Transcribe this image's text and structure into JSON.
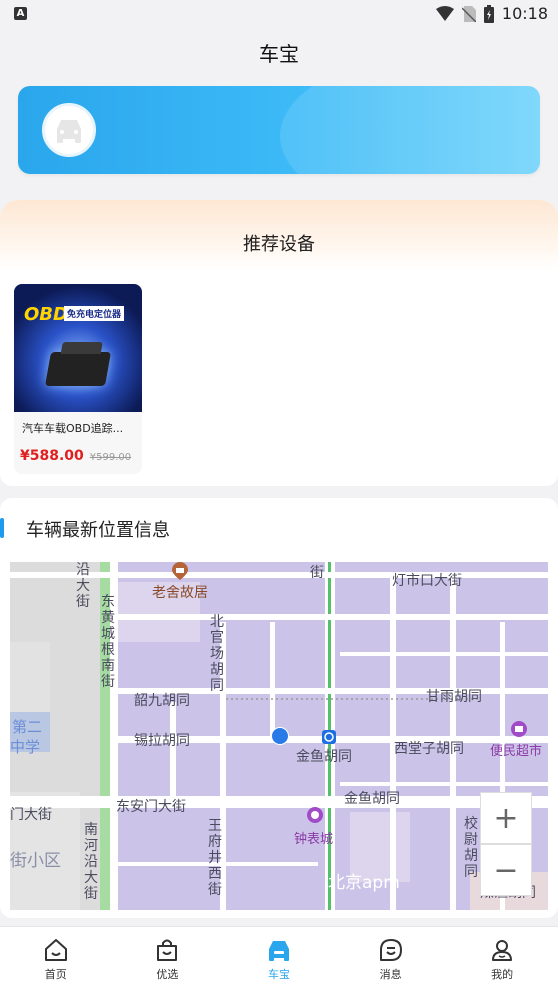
{
  "status_bar": {
    "time": "10:18",
    "badge": "A"
  },
  "header": {
    "title": "车宝"
  },
  "recommend": {
    "title": "推荐设备",
    "product": {
      "image_text": "OBD",
      "image_tag": "免充电定位器",
      "name": "汽车车载OBD追踪...",
      "price": "¥588.00",
      "old_price": "¥599.00"
    }
  },
  "location": {
    "title": "车辆最新位置信息",
    "map_labels": {
      "laoshe": "老舍故居",
      "dengshikou": "灯市口大街",
      "jie_top": "街",
      "yanda": "沿大街",
      "donghuang": "东黄城根南街",
      "beiguan": "北官场胡同",
      "shaojiu": "韶九胡同",
      "ganyu": "甘雨胡同",
      "dier": "第二",
      "zhongxue": "中学",
      "xila": "锡拉胡同",
      "jinyu1": "金鱼胡同",
      "xitangzi": "西堂子胡同",
      "bianmin": "便民超市",
      "damen": "门大街",
      "dongan": "东安门大街",
      "jinyu2": "金鱼胡同",
      "xiaowei": "校尉胡同",
      "nanhe": "南河沿大街",
      "wangfu": "王府井西街",
      "zhongbiao": "钟表城",
      "beijingapm": "北京apm",
      "xiaoqu": "街小区",
      "meizha": "煤渣胡同"
    },
    "zoom_in": "+",
    "zoom_out": "−"
  },
  "tabs": [
    {
      "label": "首页",
      "icon": "home-icon"
    },
    {
      "label": "优选",
      "icon": "bag-icon"
    },
    {
      "label": "车宝",
      "icon": "car-icon"
    },
    {
      "label": "消息",
      "icon": "message-icon"
    },
    {
      "label": "我的",
      "icon": "user-icon"
    }
  ],
  "colors": {
    "accent": "#2aa6ec",
    "price": "#e02020"
  }
}
